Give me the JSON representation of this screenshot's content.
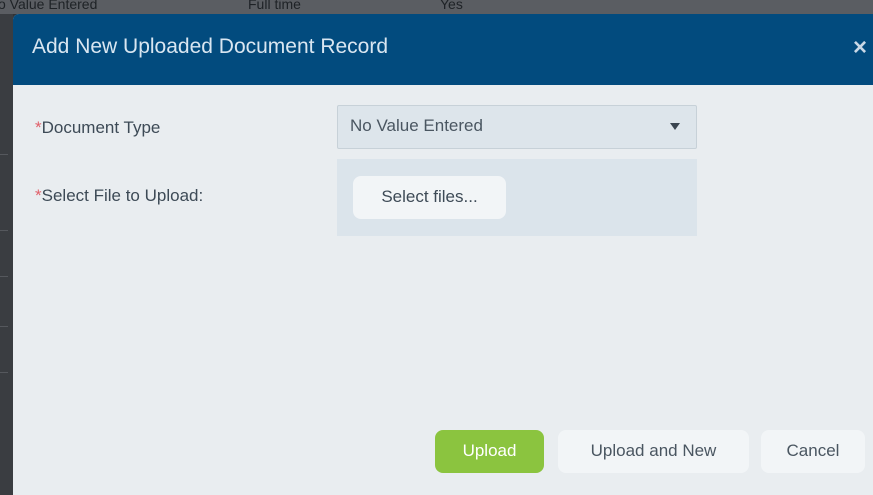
{
  "background": {
    "row_cells": [
      "o Value Entered",
      "Full time",
      "Yes"
    ]
  },
  "dialog": {
    "title": "Add New Uploaded Document Record",
    "close_icon": "×"
  },
  "form": {
    "document_type": {
      "required_marker": "*",
      "label": "Document Type",
      "selected_value": "No Value Entered"
    },
    "file_upload": {
      "required_marker": "*",
      "label": "Select File to Upload:",
      "button_label": "Select files..."
    }
  },
  "footer": {
    "upload_label": "Upload",
    "upload_and_new_label": "Upload and New",
    "cancel_label": "Cancel"
  },
  "colors": {
    "header": "#024b7e",
    "primary_button": "#8bc43f",
    "required": "#e0606a"
  }
}
